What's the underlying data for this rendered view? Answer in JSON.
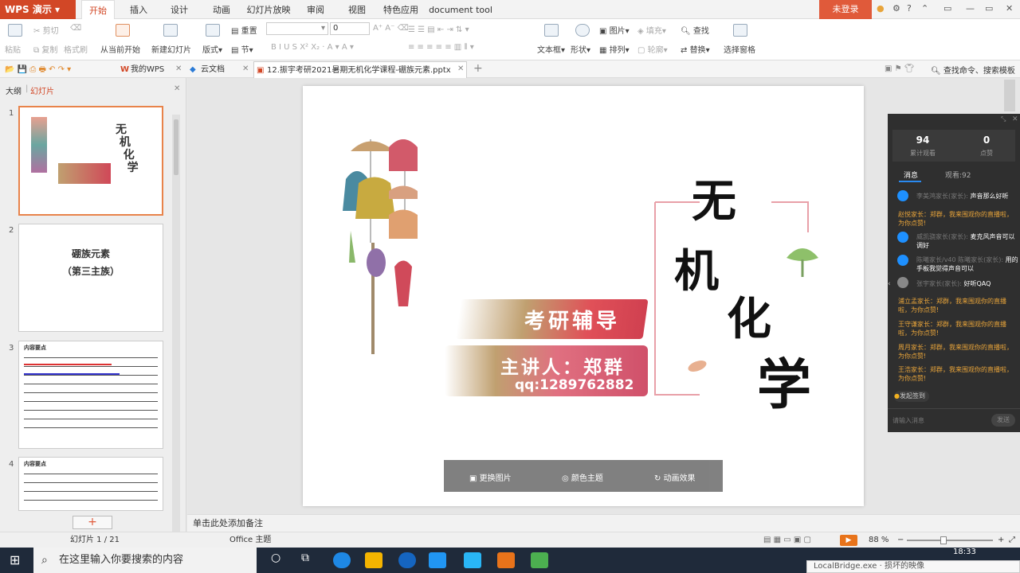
{
  "app": {
    "name": "WPS 演示",
    "login": "未登录"
  },
  "menu": [
    "开始",
    "插入",
    "设计",
    "动画",
    "幻灯片放映",
    "审阅",
    "视图",
    "特色应用",
    "document tool"
  ],
  "ribbon": {
    "paste": "粘贴",
    "cut": "剪切",
    "copy": "复制",
    "format_painter": "格式刷",
    "from_current": "从当前开始",
    "new_slide": "新建幻灯片",
    "layout": "版式",
    "reset": "重置",
    "section": "节",
    "font_size": "0",
    "textbox": "文本框",
    "shape": "形状",
    "picture": "图片",
    "fill": "填充",
    "outline": "轮廓",
    "arrange": "排列",
    "find": "查找",
    "replace": "替换",
    "select_pane": "选择窗格"
  },
  "tabs": {
    "my_wps": "我的WPS",
    "cloud": "云文档",
    "doc": "12.振宇考研2021暑期无机化学课程-硼族元素.pptx",
    "search_hint": "查找命令、搜索模板"
  },
  "leftpane": {
    "tab_outline": "大纲",
    "tab_slides": "幻灯片",
    "slide_numbers": [
      "1",
      "2",
      "3",
      "4"
    ],
    "slide2_title1": "硼族元素",
    "slide2_title2": "（第三主族）",
    "slide3_head": "内容要点",
    "slide4_head": "内容要点",
    "add": "+"
  },
  "slide": {
    "title_chars": [
      "无",
      "机",
      "化",
      "学"
    ],
    "tag": "考研辅导",
    "lecturer": "主讲人：郑群",
    "qq": "qq:1289762882",
    "toolbar": [
      "更换图片",
      "颜色主题",
      "动画效果"
    ]
  },
  "notes": "单击此处添加备注",
  "live": {
    "viewers": "94",
    "viewers_label": "累计观看",
    "likes": "0",
    "likes_label": "点赞",
    "tab_msg": "消息",
    "tab_watch": "观看:92",
    "messages": [
      {
        "user": "李美鸿家长(家长):",
        "text": "声音那么好听"
      },
      {
        "user": "",
        "text": "赵悦家长：郑群，我来围观你的直播啦，为你点赞!"
      },
      {
        "user": "威凯骁家长(家长):",
        "text": "麦克风声音可以调好"
      },
      {
        "user": "陈曦家长/v40 陈曦家长(家长):",
        "text": "用的手板我觉得声音可以"
      },
      {
        "user": "张宇家长(家长):",
        "text": "好听QAQ"
      },
      {
        "user": "",
        "text": "浦立孟家长：郑群，我来围观你的直播啦，为你点赞!"
      },
      {
        "user": "",
        "text": "王守谦家长：郑群，我来围观你的直播啦，为你点赞!"
      },
      {
        "user": "",
        "text": "周月家长：郑群，我来围观你的直播啦，为你点赞!"
      },
      {
        "user": "",
        "text": "王浩家长：郑群，我来围观你的直播啦，为你点赞!"
      }
    ],
    "signin": "发起签到",
    "input_placeholder": "请输入消息",
    "send": "发送"
  },
  "status": {
    "slide_pos": "幻灯片 1 / 21",
    "theme": "Office 主题",
    "zoom": "88 %"
  },
  "taskbar": {
    "search": "在这里输入你要搜索的内容",
    "time": "18:33",
    "tooltip": "LocalBridge.exe · 损坏的映像"
  },
  "colors": {
    "accent": "#d24726",
    "orange_msg": "#e8a43a"
  }
}
